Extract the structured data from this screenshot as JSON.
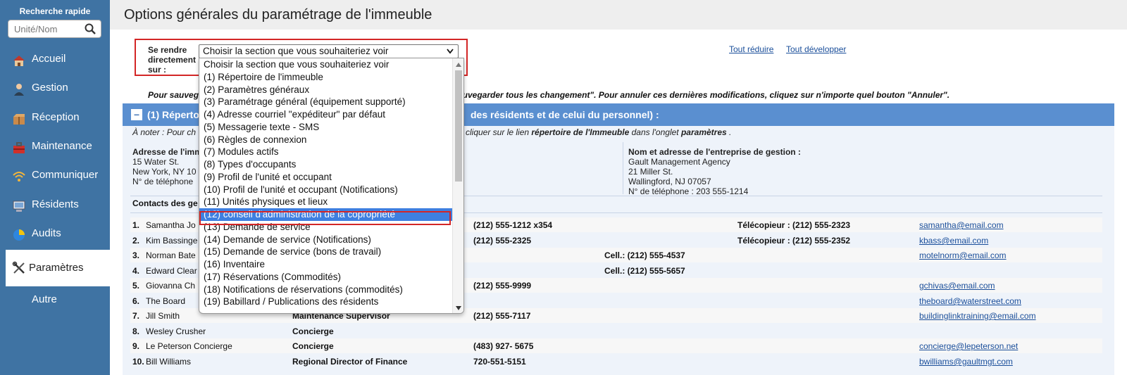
{
  "sidebar": {
    "quick_search_title": "Recherche rapide",
    "quick_search_placeholder": "Unité/Nom",
    "items": [
      {
        "label": "Accueil",
        "icon": "house-icon"
      },
      {
        "label": "Gestion",
        "icon": "person-icon"
      },
      {
        "label": "Réception",
        "icon": "package-icon"
      },
      {
        "label": "Maintenance",
        "icon": "toolbox-icon"
      },
      {
        "label": "Communiquer",
        "icon": "wifi-icon"
      },
      {
        "label": "Résidents",
        "icon": "monitor-icon"
      },
      {
        "label": "Audits",
        "icon": "pie-chart-icon"
      },
      {
        "label": "Paramètres",
        "icon": "tools-icon",
        "active": true
      },
      {
        "label": "Autre",
        "icon": ""
      }
    ]
  },
  "page_title": "Options générales du paramétrage de l'immeuble",
  "goto": {
    "label": "Se rendre directement sur :",
    "selected": "Choisir la section que vous souhaiteriez voir"
  },
  "links": {
    "collapse": "Tout réduire",
    "expand": "Tout développer"
  },
  "save_note_left": "Pour sauveg",
  "save_note_right": "auvegarder tous les changement\". Pour annuler ces dernières modifications, cliquez sur n'importe quel bouton \"Annuler\".",
  "section": {
    "title_left": "(1) Répertoi",
    "title_right": "des résidents et de celui du personnel) :",
    "toggle": "–"
  },
  "note_left": "À noter : Pour ch",
  "note_right_prefix": "cliquer sur le lien ",
  "note_right_bold1": "répertoire de l'Immeuble",
  "note_right_mid": " dans l'onglet ",
  "note_right_bold2": "paramètres",
  "note_right_suffix": " .",
  "building_address": {
    "heading": "Adresse de l'imm",
    "line1": "15 Water St.",
    "line2": "New York, NY 10",
    "line3": "N° de téléphone"
  },
  "management": {
    "heading": "Nom et adresse de l'entreprise de gestion :",
    "name": "Gault Management Agency",
    "street": "21 Miller St.",
    "city": "Wallingford, NJ 07057",
    "phone": "N° de téléphone : 203 555-1214"
  },
  "contacts_heading": "Contacts des ge",
  "contacts": [
    {
      "num": "1.",
      "name": "Samantha Jo",
      "role": "",
      "phone": "(212) 555-1212 x354",
      "cell": "",
      "fax": "Télécopieur : (212) 555-2323",
      "email": "samantha@email.com"
    },
    {
      "num": "2.",
      "name": "Kim Bassinge",
      "role": "",
      "phone": "(212) 555-2325",
      "cell": "",
      "fax": "Télécopieur : (212) 555-2352",
      "email": "kbass@email.com"
    },
    {
      "num": "3.",
      "name": "Norman Bate",
      "role": "",
      "phone": "",
      "cell": "Cell.: (212) 555-4537",
      "fax": "",
      "email": "motelnorm@email.com"
    },
    {
      "num": "4.",
      "name": "Edward Clear",
      "role": "",
      "phone": "",
      "cell": "Cell.: (212) 555-5657",
      "fax": "",
      "email": ""
    },
    {
      "num": "5.",
      "name": "Giovanna Ch",
      "role": "",
      "phone": "(212) 555-9999",
      "cell": "",
      "fax": "",
      "email": "gchivas@email.com"
    },
    {
      "num": "6.",
      "name": "The Board",
      "role": "",
      "phone": "",
      "cell": "",
      "fax": "",
      "email": "theboard@waterstreet.com"
    },
    {
      "num": "7.",
      "name": "Jill Smith",
      "role": "Maintenance Supervisor",
      "phone": "(212) 555-7117",
      "cell": "",
      "fax": "",
      "email": "buildinglinktraining@email.com"
    },
    {
      "num": "8.",
      "name": "Wesley Crusher",
      "role": "Concierge",
      "phone": "",
      "cell": "",
      "fax": "",
      "email": ""
    },
    {
      "num": "9.",
      "name": "Le Peterson Concierge",
      "role": "Concierge",
      "phone": "(483) 927- 5675",
      "cell": "",
      "fax": "",
      "email": "concierge@lepeterson.net"
    },
    {
      "num": "10.",
      "name": "Bill Williams",
      "role": "Regional Director of Finance",
      "phone": "720-551-5151",
      "cell": "",
      "fax": "",
      "email": "bwilliams@gaultmgt.com"
    }
  ],
  "dropdown_options": [
    "Choisir la section que vous souhaiteriez voir",
    "(1) Répertoire de l'immeuble",
    "(2) Paramètres généraux",
    "(3) Paramétrage général (équipement supporté)",
    "(4) Adresse courriel \"expéditeur\" par défaut",
    "(5) Messagerie texte - SMS",
    "(6) Règles de connexion",
    "(7) Modules actifs",
    "(8) Types d'occupants",
    "(9) Profil de l'unité et occupant",
    "(10) Profil de l'unité et occupant (Notifications)",
    "(11) Unités physiques et lieux",
    "(12) conseil d'administration de la copropriété",
    "(13) Demande de service",
    "(14) Demande de service (Notifications)",
    "(15) Demande de service (bons de travail)",
    "(16) Inventaire",
    "(17) Réservations (Commodités)",
    "(18) Notifications de réservations (commodités)",
    "(19) Babillard / Publications des résidents"
  ],
  "dropdown_highlighted_index": 12,
  "colors": {
    "sidebar": "#3f73a3",
    "section_bar": "#5a8fd0",
    "highlight": "#3e7fe0",
    "red_outline": "#d32626",
    "link": "#1a4e9a"
  }
}
